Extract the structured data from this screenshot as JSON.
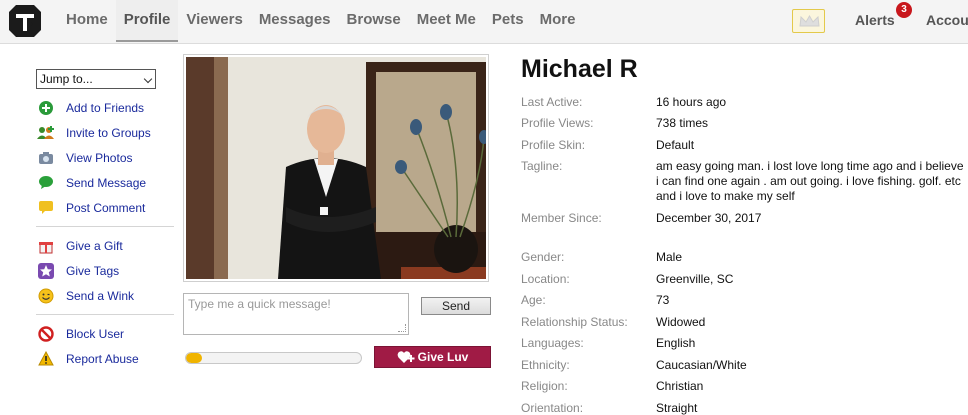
{
  "nav": {
    "items": [
      "Home",
      "Profile",
      "Viewers",
      "Messages",
      "Browse",
      "Meet Me",
      "Pets",
      "More"
    ],
    "active": "Profile",
    "alerts_label": "Alerts",
    "alerts_count": "3",
    "account_label": "Account"
  },
  "sidebar": {
    "jump_label": "Jump to...",
    "groups": [
      [
        {
          "label": "Add to Friends",
          "icon": "add-friend-icon"
        },
        {
          "label": "Invite to Groups",
          "icon": "invite-groups-icon"
        },
        {
          "label": "View Photos",
          "icon": "camera-icon"
        },
        {
          "label": "Send Message",
          "icon": "speech-bubble-icon"
        },
        {
          "label": "Post Comment",
          "icon": "comment-icon"
        }
      ],
      [
        {
          "label": "Give a Gift",
          "icon": "gift-icon"
        },
        {
          "label": "Give Tags",
          "icon": "star-icon"
        },
        {
          "label": "Send a Wink",
          "icon": "smiley-icon"
        }
      ],
      [
        {
          "label": "Block User",
          "icon": "block-icon"
        },
        {
          "label": "Report Abuse",
          "icon": "warning-icon"
        }
      ]
    ]
  },
  "message": {
    "placeholder": "Type me a quick message!",
    "send_label": "Send"
  },
  "luv": {
    "label": "Give Luv",
    "progress": 0.09
  },
  "profile": {
    "name": "Michael R",
    "fields": [
      {
        "label": "Last Active:",
        "value": "16 hours ago"
      },
      {
        "label": "Profile Views:",
        "value": "738 times"
      },
      {
        "label": "Profile Skin:",
        "value": "Default"
      },
      {
        "label": "Tagline:",
        "value": "am easy going man. i lost love long time ago and i believe i can find one again . am out going. i love fishing. golf. etc and i love to make my self"
      },
      {
        "label": "Member Since:",
        "value": "December 30, 2017"
      },
      {
        "label": "Gender:",
        "value": "Male"
      },
      {
        "label": "Location:",
        "value": "Greenville, SC"
      },
      {
        "label": "Age:",
        "value": "73"
      },
      {
        "label": "Relationship Status:",
        "value": "Widowed"
      },
      {
        "label": "Languages:",
        "value": "English"
      },
      {
        "label": "Ethnicity:",
        "value": "Caucasian/White"
      },
      {
        "label": "Religion:",
        "value": "Christian"
      },
      {
        "label": "Orientation:",
        "value": "Straight"
      }
    ]
  },
  "colors": {
    "link": "#1a2a9c",
    "luv_button": "#a01b45",
    "progress_fill": "#f0b400",
    "badge": "#c8171c"
  }
}
